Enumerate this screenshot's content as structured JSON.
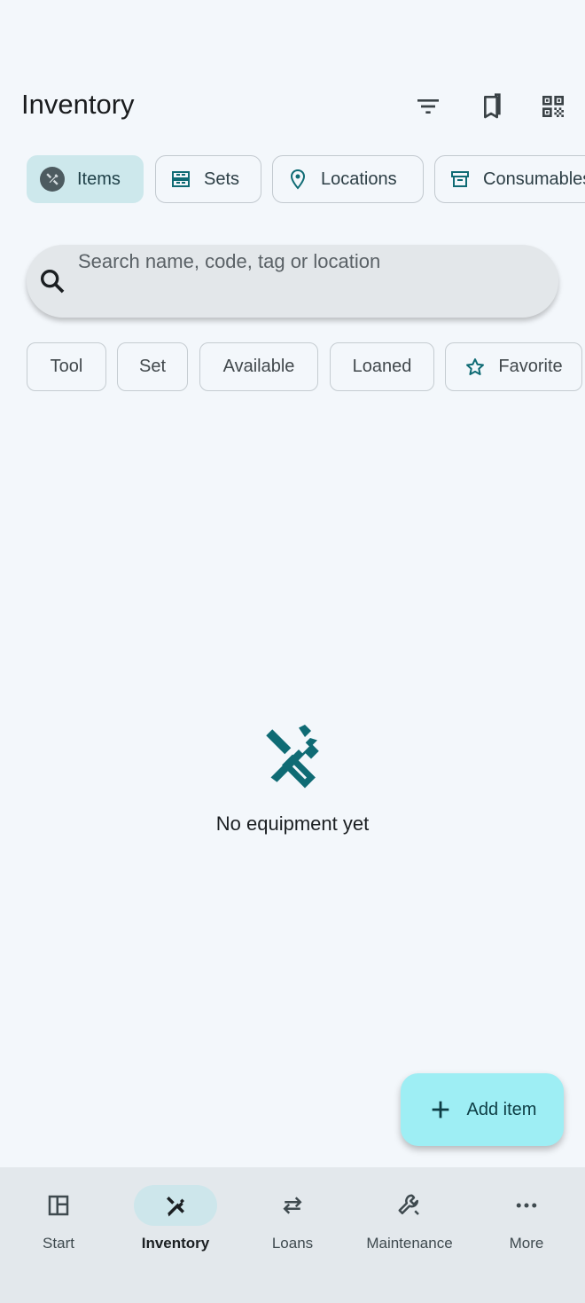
{
  "header": {
    "title": "Inventory",
    "icons": [
      "filter-icon",
      "bookmarks-icon",
      "qr-code-icon"
    ]
  },
  "segments": [
    {
      "label": "Items",
      "icon": "tools-icon",
      "selected": true
    },
    {
      "label": "Sets",
      "icon": "grid-boxes-icon",
      "selected": false
    },
    {
      "label": "Locations",
      "icon": "location-pin-icon",
      "selected": false
    },
    {
      "label": "Consumables",
      "icon": "archive-box-icon",
      "selected": false
    }
  ],
  "search": {
    "placeholder": "Search name, code, tag or location",
    "value": ""
  },
  "filters": [
    {
      "label": "Tool"
    },
    {
      "label": "Set"
    },
    {
      "label": "Available"
    },
    {
      "label": "Loaned"
    },
    {
      "label": "Favorite",
      "icon": "star-outline-icon"
    }
  ],
  "empty_state": {
    "icon": "tools-icon",
    "message": "No equipment yet"
  },
  "fab": {
    "label": "Add item",
    "icon": "plus-icon"
  },
  "nav": [
    {
      "label": "Start",
      "icon": "dashboard-icon",
      "selected": false
    },
    {
      "label": "Inventory",
      "icon": "tools-icon",
      "selected": true
    },
    {
      "label": "Loans",
      "icon": "swap-arrows-icon",
      "selected": false
    },
    {
      "label": "Maintenance",
      "icon": "wrench-icon",
      "selected": false
    },
    {
      "label": "More",
      "icon": "more-horiz-icon",
      "selected": false
    }
  ],
  "colors": {
    "background": "#f3f7fb",
    "accent": "#0f6b74",
    "selected_chip": "#cde8ec",
    "fab": "#9eeef4",
    "navbar": "#e3e8ec"
  }
}
